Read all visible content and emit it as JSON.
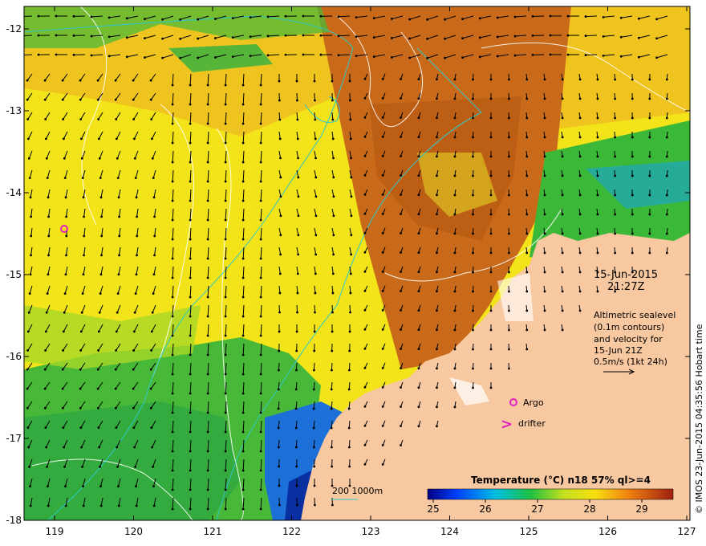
{
  "map": {
    "axes": {
      "x_ticks": [
        "119",
        "120",
        "121",
        "122",
        "123",
        "124",
        "125",
        "126",
        "127"
      ],
      "y_ticks": [
        "-12",
        "-13",
        "-14",
        "-15",
        "-16",
        "-17",
        "-18"
      ]
    },
    "datetime": {
      "date": "15-Jun-2015",
      "time": "21:27Z"
    },
    "description": {
      "line1": "Altimetric sealevel",
      "line2": "(0.1m contours)",
      "line3": "and velocity for",
      "line4": "15-Jun 21Z",
      "line5": "0.5m/s (1kt 24h)"
    },
    "legend": {
      "argo_label": "Argo",
      "drifter_label": "drifter",
      "drifter_symbol": ">"
    },
    "bathymetry_label": "200  1000m",
    "colorbar": {
      "title": "Temperature (°C) n18 57% ql>=4",
      "ticks": [
        "25",
        "26",
        "27",
        "28",
        "29"
      ]
    },
    "credit": "© IMOS 23-Jun-2015 04:35:56 Hobart time",
    "colors": {
      "land": "#f8c8a0",
      "warm": "#c86414",
      "mid": "#f0e020",
      "cool": "#20b040",
      "cold": "#1060e0",
      "argo": "#e020c0",
      "bathy": "#30c8c8"
    }
  }
}
